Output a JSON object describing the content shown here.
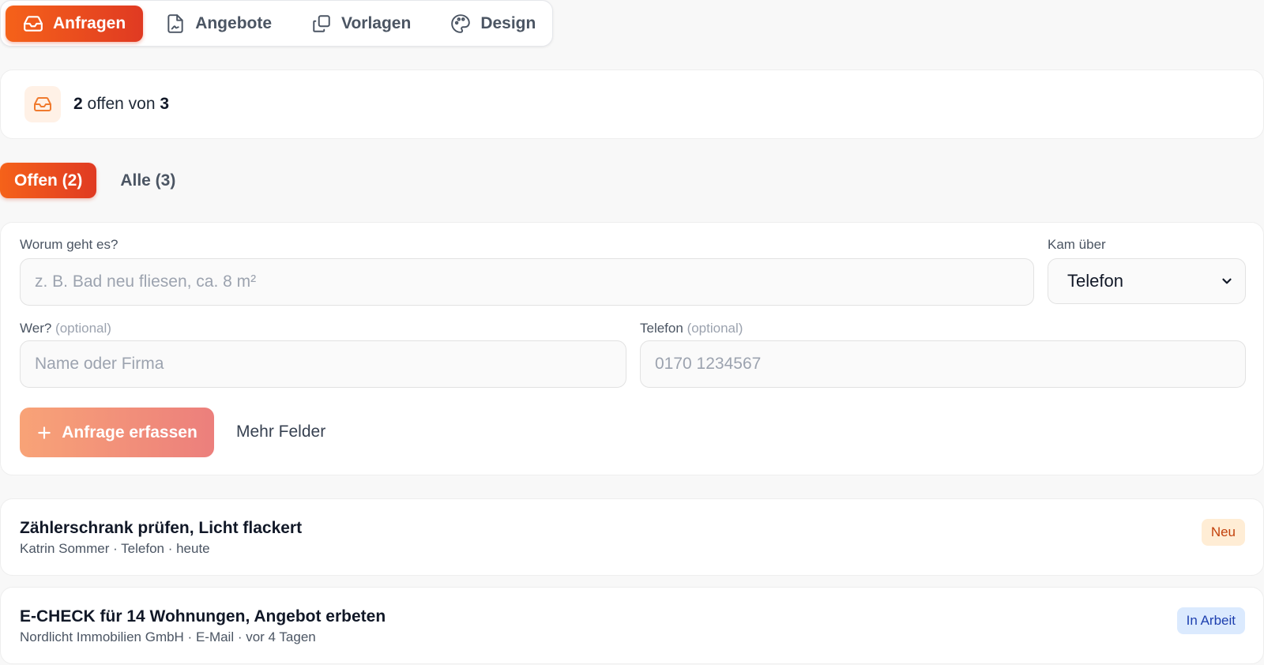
{
  "nav": {
    "tabs": [
      {
        "label": "Anfragen",
        "icon": "inbox-icon",
        "active": true
      },
      {
        "label": "Angebote",
        "icon": "file-signature-icon",
        "active": false
      },
      {
        "label": "Vorlagen",
        "icon": "copy-icon",
        "active": false
      },
      {
        "label": "Design",
        "icon": "palette-icon",
        "active": false
      }
    ]
  },
  "summary": {
    "open_count": "2",
    "middle_text": " offen von ",
    "total_count": "3",
    "icon": "inbox-icon"
  },
  "filters": {
    "tabs": [
      {
        "label": "Offen (2)",
        "active": true
      },
      {
        "label": "Alle (3)",
        "active": false
      }
    ]
  },
  "form": {
    "topic_label": "Worum geht es?",
    "topic_placeholder": "z. B. Bad neu fliesen, ca. 8 m²",
    "source_label": "Kam über",
    "source_value": "Telefon",
    "who_label": "Wer?",
    "who_optional": "(optional)",
    "who_placeholder": "Name oder Firma",
    "phone_label": "Telefon",
    "phone_optional": "(optional)",
    "phone_placeholder": "0170 1234567",
    "submit_label": "Anfrage erfassen",
    "more_fields_label": "Mehr Felder"
  },
  "requests": [
    {
      "title": "Zählerschrank prüfen, Licht flackert",
      "meta": "Katrin Sommer · Telefon · heute",
      "status": "Neu",
      "status_bg": "#ffedd5",
      "status_color": "#c2410c"
    },
    {
      "title": "E-CHECK für 14 Wohnungen, Angebot erbeten",
      "meta": "Nordlicht Immobilien GmbH · E-Mail · vor 4 Tagen",
      "status": "In Arbeit",
      "status_bg": "#dbeafe",
      "status_color": "#1e40af"
    }
  ],
  "colors": {
    "accent": "#f5621a",
    "accent_dark": "#e03a22"
  }
}
